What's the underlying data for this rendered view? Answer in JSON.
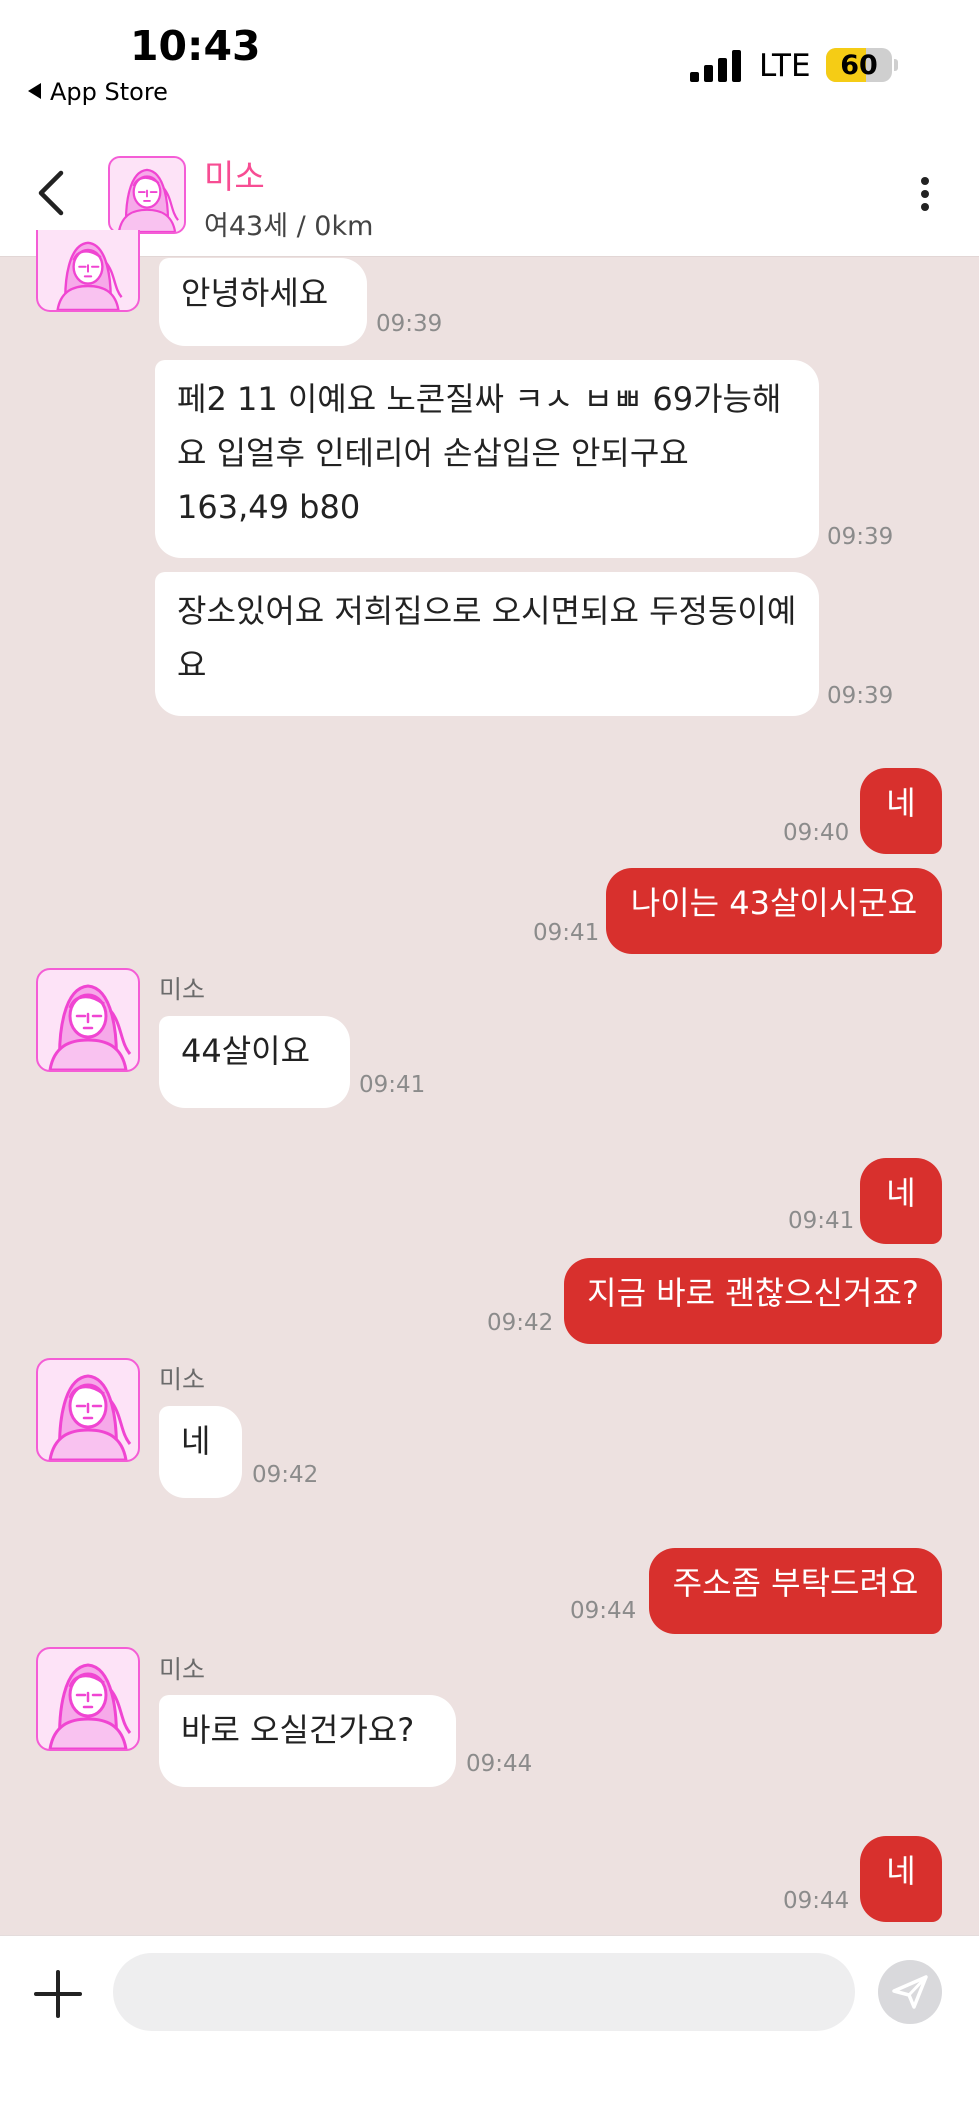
{
  "status_bar": {
    "time": "10:43",
    "back_app_label": "App Store",
    "network": "LTE",
    "battery_percent": 60,
    "battery_label": "60"
  },
  "header": {
    "contact_name": "미소",
    "contact_info": "여43세 / 0km",
    "back_icon": "chevron-left-icon",
    "more_icon": "more-vertical-icon"
  },
  "colors": {
    "chat_background": "#ede1e0",
    "outgoing_bubble": "#d8302d",
    "incoming_bubble": "#ffffff",
    "contact_name": "#f74d93",
    "avatar_border": "#f45dd6"
  },
  "messages": [
    {
      "side": "in",
      "text": "안녕하세요",
      "time": "09:39"
    },
    {
      "side": "in",
      "text": "페2 11 이예요 노콘질싸 ㅋㅅ ㅂㅃ 69가능해요 입얼후 인테리어 손삽입은 안되구요 163,49  b80",
      "time": "09:39"
    },
    {
      "side": "in",
      "text": "장소있어요 저희집으로 오시면되요 두정동이예요",
      "time": "09:39"
    },
    {
      "side": "out",
      "text": "네",
      "time": "09:40"
    },
    {
      "side": "out",
      "text": "나이는 43살이시군요",
      "time": "09:41"
    },
    {
      "side": "in",
      "sender": "미소",
      "text": "44살이요",
      "time": "09:41"
    },
    {
      "side": "out",
      "text": "네",
      "time": "09:41"
    },
    {
      "side": "out",
      "text": "지금 바로 괜찮으신거죠?",
      "time": "09:42"
    },
    {
      "side": "in",
      "sender": "미소",
      "text": "네",
      "time": "09:42"
    },
    {
      "side": "out",
      "text": "주소좀 부탁드려요",
      "time": "09:44"
    },
    {
      "side": "in",
      "sender": "미소",
      "text": "바로 오실건가요?",
      "time": "09:44"
    },
    {
      "side": "out",
      "text": "네",
      "time": "09:44"
    }
  ],
  "composer": {
    "plus_icon": "plus-icon",
    "input_value": "",
    "input_placeholder": "",
    "send_icon": "send-icon"
  }
}
